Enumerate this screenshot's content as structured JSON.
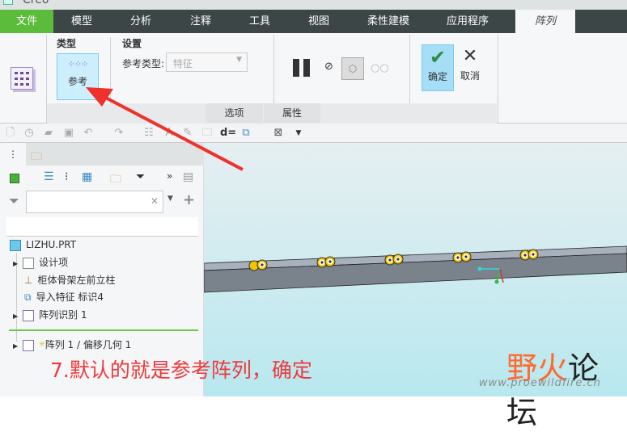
{
  "window": {
    "title": "Creo"
  },
  "menu": {
    "file": "文件",
    "tabs": [
      "模型",
      "分析",
      "注释",
      "工具",
      "视图",
      "柔性建模",
      "应用程序"
    ],
    "active": "阵列"
  },
  "ribbon": {
    "type_group": "类型",
    "type_button": "参考",
    "settings_group": "设置",
    "ref_type_label": "参考类型:",
    "ref_type_value": "特征",
    "ok": "确定",
    "cancel": "取消",
    "tab_options": "选项",
    "tab_properties": "属性"
  },
  "tree": {
    "root": "LIZHU.PRT",
    "items": [
      "设计项",
      "柜体骨架左前立柱",
      "导入特征 标识4",
      "阵列识别 1"
    ],
    "inserting": "阵列 1 / 偏移几何 1"
  },
  "search": {
    "placeholder": ""
  },
  "annotation": "7.默认的就是参考阵列，确定",
  "watermark": {
    "name": "野火论坛",
    "url": "www.proewildfire.cn"
  },
  "colors": {
    "menubar": "#3c4646",
    "file_tab": "#5bbb3a",
    "accent": "#a6def8",
    "annotation": "#f0383c"
  }
}
